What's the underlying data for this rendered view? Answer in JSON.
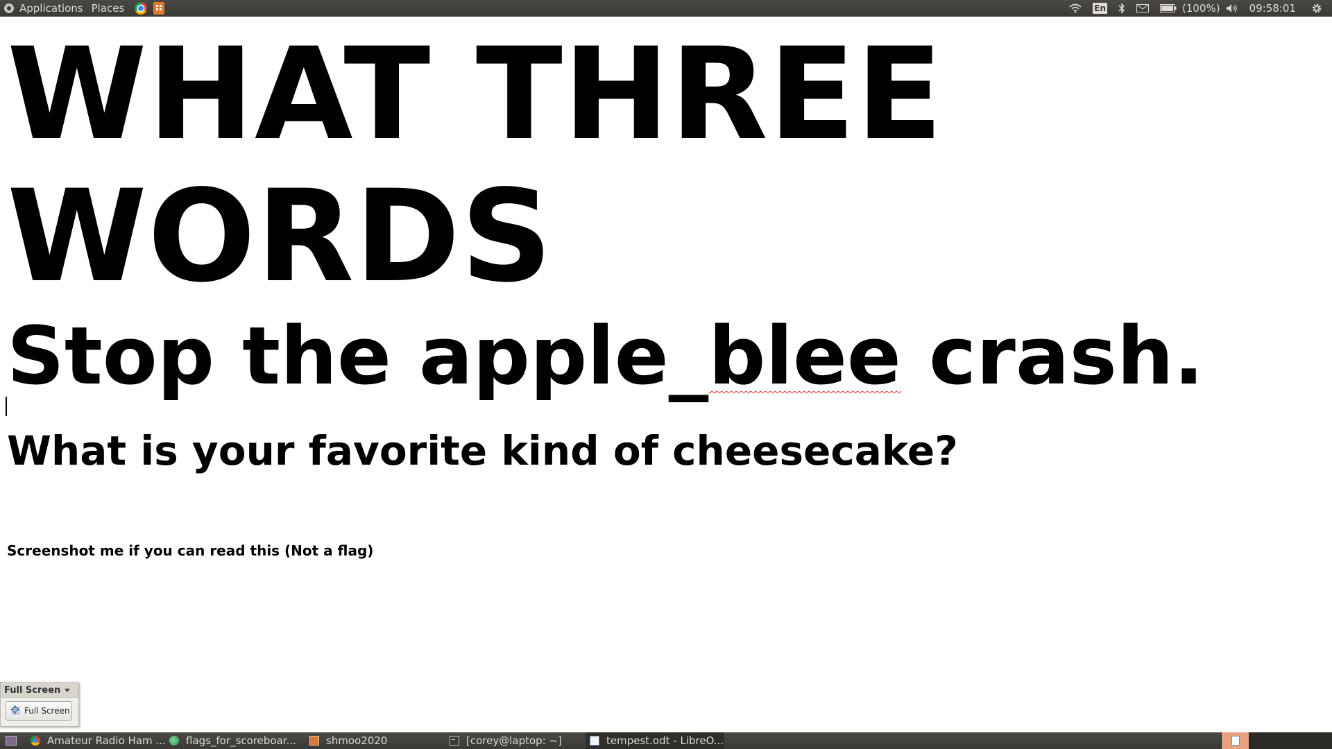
{
  "top_panel": {
    "menus": [
      "Applications",
      "Places"
    ],
    "language": "En",
    "battery_percent": "(100%)",
    "clock": "09:58:01",
    "icons": [
      "ubuntu-menu-icon",
      "chrome-launcher-icon",
      "sublime-launcher-icon",
      "wifi-icon",
      "bluetooth-icon",
      "mail-icon",
      "battery-icon",
      "volume-icon",
      "gear-icon"
    ]
  },
  "document": {
    "heading_huge": "WHAT THREE\n WORDS",
    "heading_big_pre": "Stop the apple_",
    "heading_big_misspelled": "blee",
    "heading_big_post": " crash.",
    "heading_mid": "What is your favorite kind of cheesecake?",
    "small_text": "Screenshot me if you can read this (Not a flag)"
  },
  "fullscreen_toolbar": {
    "title": "Full Screen",
    "button_label": "Full Screen"
  },
  "taskbar": {
    "tasks": [
      {
        "label": "Amateur Radio Ham ...",
        "icon": "chrome-icon"
      },
      {
        "label": "flags_for_scoreboar...",
        "icon": "globe-icon"
      },
      {
        "label": "shmoo2020",
        "icon": "image-viewer-icon"
      },
      {
        "label": "[corey@laptop: ~]",
        "icon": "terminal-icon"
      },
      {
        "label": "tempest.odt - LibreO...",
        "icon": "writer-doc-icon"
      }
    ]
  },
  "colors": {
    "panel_bg": "#3b3a36",
    "panel_text": "#dfdbd2",
    "spellcheck_underline": "#e03030",
    "active_workspace": "#e8a080"
  }
}
